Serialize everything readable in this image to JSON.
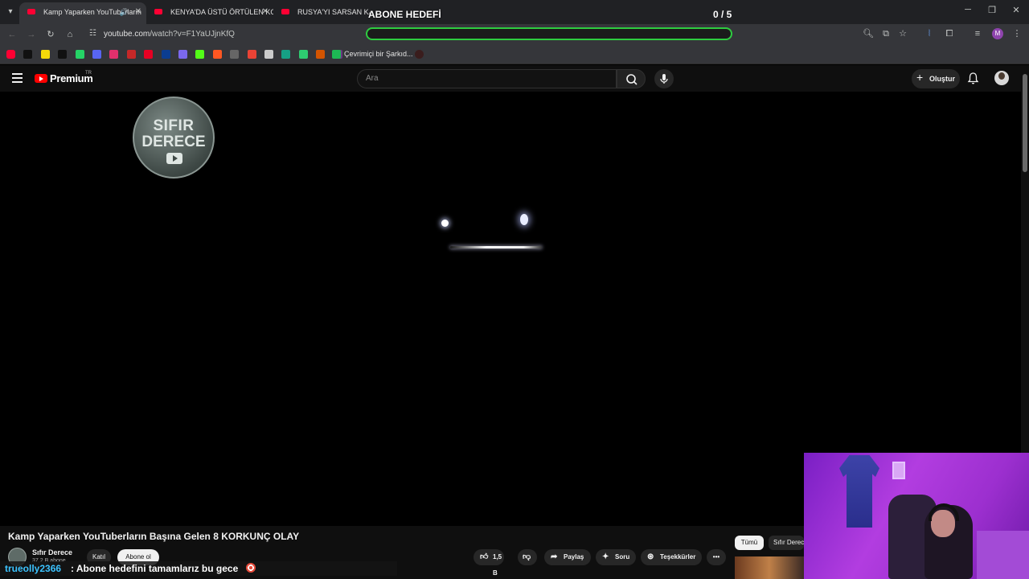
{
  "browser": {
    "tabs": [
      {
        "title": "Kamp Yaparken YouTuberların",
        "active": true,
        "audio": true
      },
      {
        "title": "KENYA'DA ÜSTÜ ÖRTÜLEN KOR",
        "active": false
      },
      {
        "title": "RUSYA'YI SARSAN KARANLIK",
        "active": false
      }
    ],
    "close_glyph": "✕",
    "sound_glyph": "🔊",
    "url_domain": "youtube.com",
    "url_path": "/watch?v=F1YaUJjnKfQ",
    "profile_initial": "M",
    "bookmark_label": "Çevrimiçi bir Şarkıd...",
    "bookmark_colors": [
      "#ff0033",
      "#111111",
      "#f5d90a",
      "#111111",
      "#25d366",
      "#5865f2",
      "#e1306c",
      "#c62828",
      "#e60023",
      "#0b3d91",
      "#7b68ee",
      "#53fc18",
      "#ff5722",
      "#666666",
      "#ea4335",
      "#cccccc",
      "#16a085",
      "#2ecc71",
      "#d35400",
      "#6c3483"
    ]
  },
  "stream_overlay": {
    "goal_title": "ABONE HEDEFİ",
    "goal_count": "0 / 5",
    "goal_progress": 0,
    "bar_color": "#2ecc40"
  },
  "youtube": {
    "brand": "Premium",
    "region": "TR",
    "search_placeholder": "Ara",
    "create_label": "Oluştur"
  },
  "video": {
    "watermark_line1": "SIFIR",
    "watermark_line2": "DERECE",
    "title": "Kamp Yaparken YouTuberların Başına Gelen 8 KORKUNÇ OLAY",
    "channel_name": "Sıfır Derece",
    "channel_subs": "37,2 B abone",
    "join_label": "Katıl",
    "subscribe_label": "Abone ol",
    "likes": "1,5 B",
    "share_label": "Paylaş",
    "ask_label": "Soru",
    "thanks_label": "Teşekkürler",
    "chip_all": "Tümü",
    "chip_channel": "Sıfır Derece"
  },
  "chat": {
    "user": "trueolly2366",
    "message": ": Abone hedefini tamamlarız bu gece"
  },
  "colors": {
    "accent_red": "#ff0000",
    "chat_user": "#3cc3ff",
    "webcam_light": "#b23de0"
  }
}
